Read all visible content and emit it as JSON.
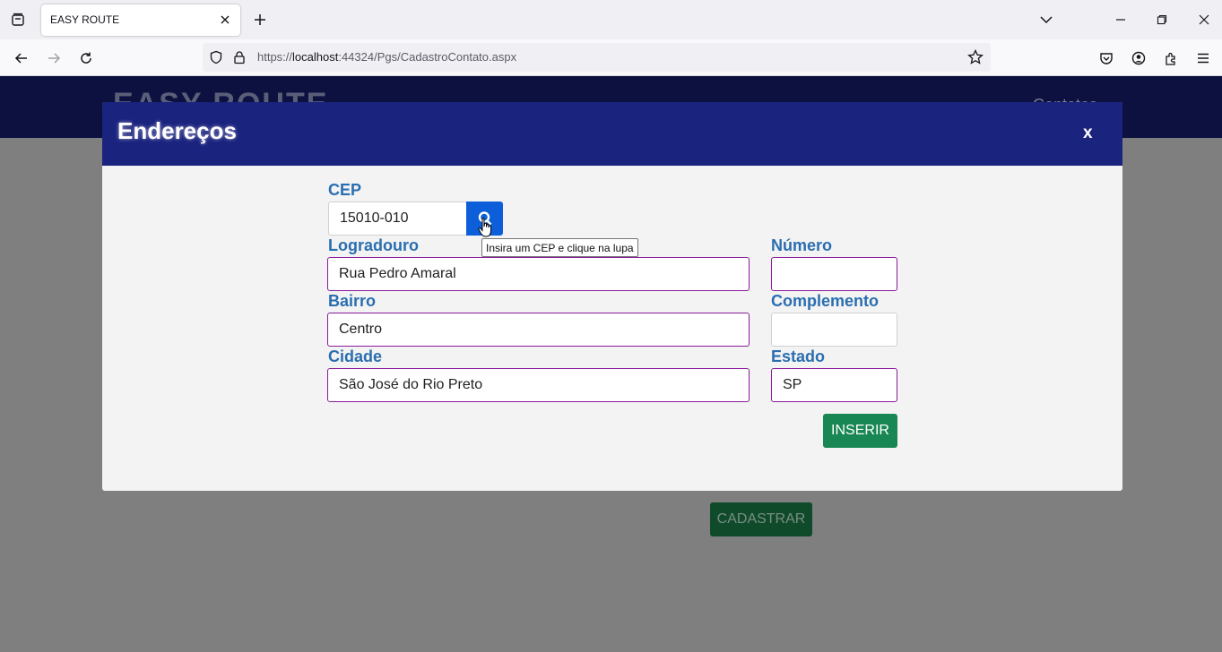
{
  "browser": {
    "tab_title": "EASY ROUTE",
    "url_prefix": "https://",
    "url_host": "localhost",
    "url_path": ":44324/Pgs/CadastroContato.aspx"
  },
  "page": {
    "logo_text": "EASY ROUTE",
    "header_link": "Contatos",
    "background_button": "CADASTRAR"
  },
  "modal": {
    "title": "Endereços",
    "close_label": "x",
    "cep": {
      "label": "CEP",
      "value": "15010-010"
    },
    "cep_tooltip": "Insira um CEP e clique na lupa",
    "logradouro": {
      "label": "Logradouro",
      "value": "Rua Pedro Amaral"
    },
    "numero": {
      "label": "Número",
      "value": ""
    },
    "bairro": {
      "label": "Bairro",
      "value": "Centro"
    },
    "complemento": {
      "label": "Complemento",
      "value": ""
    },
    "cidade": {
      "label": "Cidade",
      "value": "São José do Rio Preto"
    },
    "estado": {
      "label": "Estado",
      "value": "SP"
    },
    "insert_button": "INSERIR"
  },
  "colors": {
    "modal_header": "#1a237e",
    "label": "#2a6eb0",
    "input_border": "#8b1a9c",
    "search_button": "#0c5fd8",
    "insert_button": "#198754"
  },
  "icons": {
    "cep_search": "magnifier-icon",
    "tab_close": "close-icon",
    "new_tab": "plus-icon"
  }
}
